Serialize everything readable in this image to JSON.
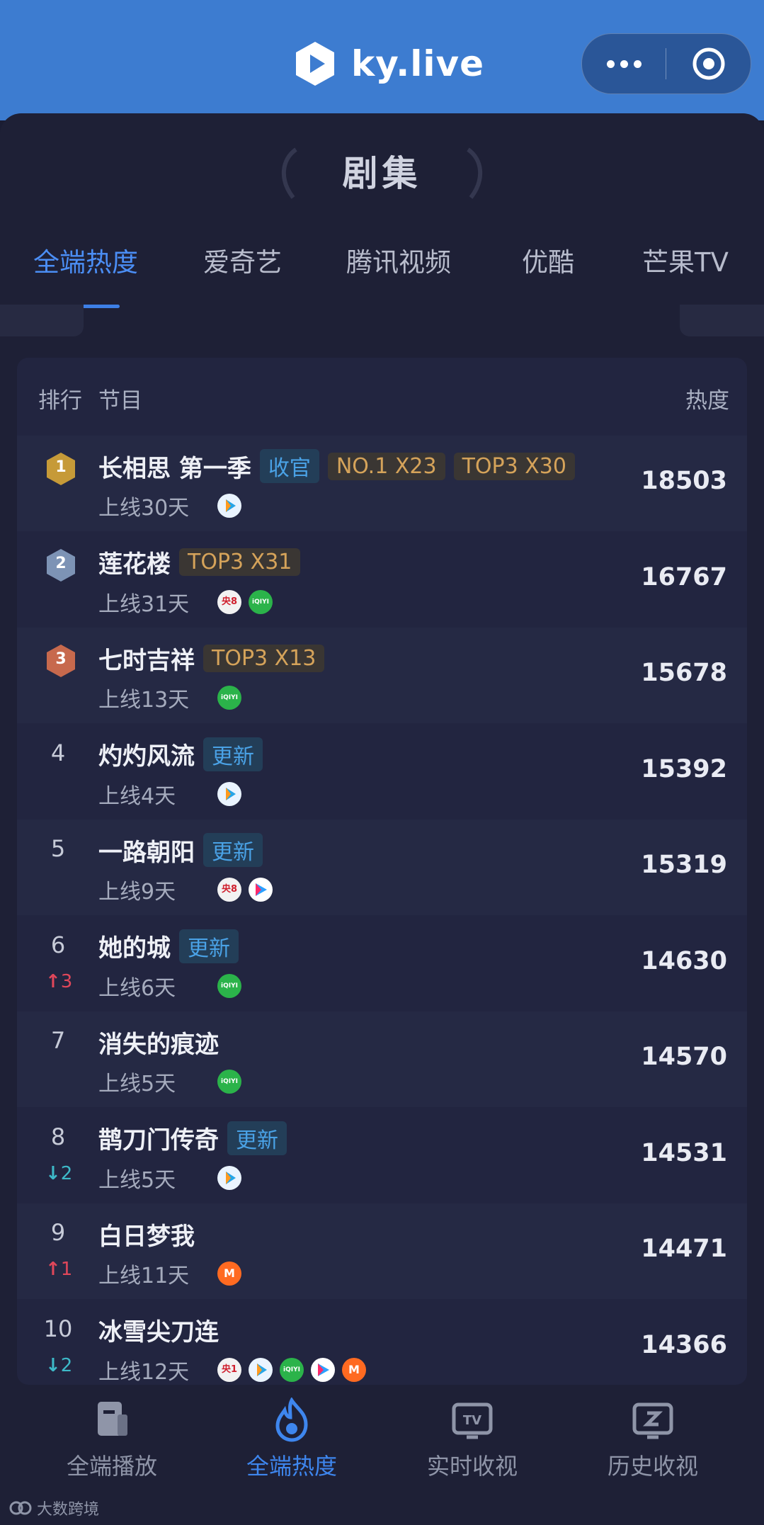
{
  "header": {
    "brand": "ky.live"
  },
  "page": {
    "section_title": "剧集"
  },
  "tabs": [
    {
      "label": "全端热度",
      "active": true
    },
    {
      "label": "爱奇艺"
    },
    {
      "label": "腾讯视频"
    },
    {
      "label": "优酷"
    },
    {
      "label": "芒果TV"
    }
  ],
  "table": {
    "headers": {
      "rank": "排行",
      "program": "节目",
      "heat": "热度"
    },
    "rows": [
      {
        "rank": "1",
        "medal": "gold",
        "title": "长相思 第一季",
        "tags": [
          {
            "text": "收官",
            "style": "blue"
          },
          {
            "text": "NO.1 X23",
            "style": "gold"
          },
          {
            "text": "TOP3 X30",
            "style": "gold"
          }
        ],
        "online": "上线30天",
        "platforms": [
          "tencent-video-icon"
        ],
        "heat": "18503"
      },
      {
        "rank": "2",
        "medal": "silver",
        "title": "莲花楼",
        "tags": [
          {
            "text": "TOP3 X31",
            "style": "gold"
          }
        ],
        "online": "上线31天",
        "platforms": [
          "cctv8-icon",
          "iqiyi-icon"
        ],
        "heat": "16767"
      },
      {
        "rank": "3",
        "medal": "bronze",
        "title": "七时吉祥",
        "tags": [
          {
            "text": "TOP3 X13",
            "style": "gold"
          }
        ],
        "online": "上线13天",
        "platforms": [
          "iqiyi-icon"
        ],
        "heat": "15678"
      },
      {
        "rank": "4",
        "title": "灼灼风流",
        "tags": [
          {
            "text": "更新",
            "style": "blue"
          }
        ],
        "online": "上线4天",
        "platforms": [
          "tencent-video-icon"
        ],
        "heat": "15392"
      },
      {
        "rank": "5",
        "title": "一路朝阳",
        "tags": [
          {
            "text": "更新",
            "style": "blue"
          }
        ],
        "online": "上线9天",
        "platforms": [
          "cctv8-icon",
          "youku-icon"
        ],
        "heat": "15319"
      },
      {
        "rank": "6",
        "change": "3",
        "change_dir": "up",
        "title": "她的城",
        "tags": [
          {
            "text": "更新",
            "style": "blue"
          }
        ],
        "online": "上线6天",
        "platforms": [
          "iqiyi-icon"
        ],
        "heat": "14630"
      },
      {
        "rank": "7",
        "title": "消失的痕迹",
        "tags": [],
        "online": "上线5天",
        "platforms": [
          "iqiyi-icon"
        ],
        "heat": "14570"
      },
      {
        "rank": "8",
        "change": "2",
        "change_dir": "down",
        "title": "鹊刀门传奇",
        "tags": [
          {
            "text": "更新",
            "style": "blue"
          }
        ],
        "online": "上线5天",
        "platforms": [
          "tencent-video-icon"
        ],
        "heat": "14531"
      },
      {
        "rank": "9",
        "change": "1",
        "change_dir": "up",
        "title": "白日梦我",
        "tags": [],
        "online": "上线11天",
        "platforms": [
          "mango-tv-icon"
        ],
        "heat": "14471"
      },
      {
        "rank": "10",
        "change": "2",
        "change_dir": "down",
        "title": "冰雪尖刀连",
        "tags": [],
        "online": "上线12天",
        "platforms": [
          "cctv1-icon",
          "tencent-video-icon",
          "iqiyi-icon",
          "youku-icon",
          "mango-tv-icon"
        ],
        "heat": "14366"
      }
    ]
  },
  "platform_badges": {
    "cctv8": "央8",
    "cctv1": "央1",
    "iqiyi": "iQIYI",
    "mango": "M"
  },
  "bottom_nav": [
    {
      "label": "全端播放"
    },
    {
      "label": "全端热度",
      "active": true
    },
    {
      "label": "实时收视"
    },
    {
      "label": "历史收视"
    }
  ],
  "footer": {
    "brand": "大数跨境"
  },
  "colors": {
    "accent": "#3e86ee",
    "topbar": "#3d7cd0",
    "tag_blue": "#4aa2e6",
    "tag_gold": "#d5a35a",
    "rank_up": "#e0475a",
    "rank_down": "#3db9c8"
  }
}
